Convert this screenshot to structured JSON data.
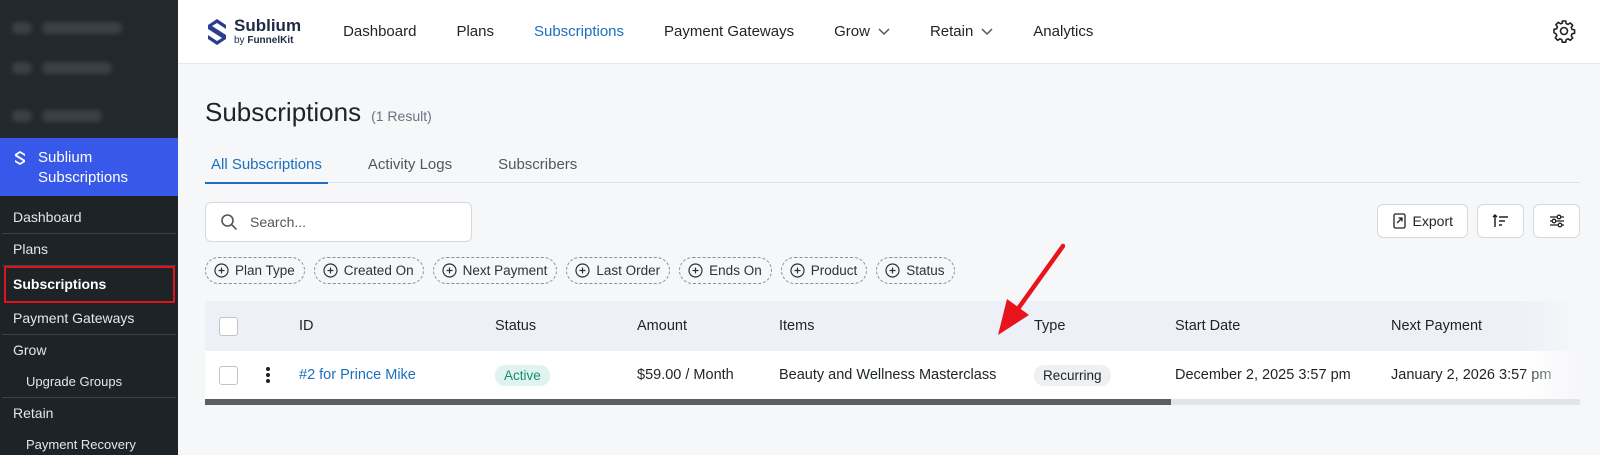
{
  "wp_sidebar": {
    "plugin_name": "Sublium Subscriptions",
    "items": [
      {
        "label": "Dashboard",
        "child": false
      },
      {
        "label": "Plans",
        "child": false
      },
      {
        "label": "Subscriptions",
        "child": false,
        "current": true
      },
      {
        "label": "Payment Gateways",
        "child": false
      },
      {
        "label": "Grow",
        "child": false
      },
      {
        "label": "Upgrade Groups",
        "child": true
      },
      {
        "label": "Retain",
        "child": false
      },
      {
        "label": "Payment Recovery",
        "child": true
      }
    ]
  },
  "brand": {
    "title": "Sublium",
    "by": "by ",
    "by_strong": "FunnelKit"
  },
  "nav": {
    "dashboard": "Dashboard",
    "plans": "Plans",
    "subscriptions": "Subscriptions",
    "payment_gateways": "Payment Gateways",
    "grow": "Grow",
    "retain": "Retain",
    "analytics": "Analytics"
  },
  "page": {
    "title": "Subscriptions",
    "count": "(1 Result)"
  },
  "tabs": {
    "all": "All Subscriptions",
    "activity": "Activity Logs",
    "subscribers": "Subscribers"
  },
  "search": {
    "placeholder": "Search..."
  },
  "toolbar": {
    "export": "Export"
  },
  "filters": [
    "Plan Type",
    "Created On",
    "Next Payment",
    "Last Order",
    "Ends On",
    "Product",
    "Status"
  ],
  "table": {
    "headers": {
      "id": "ID",
      "status": "Status",
      "amount": "Amount",
      "items": "Items",
      "type": "Type",
      "start_date": "Start Date",
      "next_payment": "Next Payment"
    },
    "rows": [
      {
        "id": "#2 for Prince Mike",
        "status": "Active",
        "amount": "$59.00 / Month",
        "items": "Beauty and Wellness Masterclass",
        "type": "Recurring",
        "start_date": "December 2, 2025 3:57 pm",
        "next_payment": "January 2, 2026 3:57 pm"
      }
    ]
  },
  "colors": {
    "accent": "#1b6fbf",
    "wp_active": "#3858e9",
    "highlight_box": "#e2141b",
    "arrow": "#e8141b"
  }
}
